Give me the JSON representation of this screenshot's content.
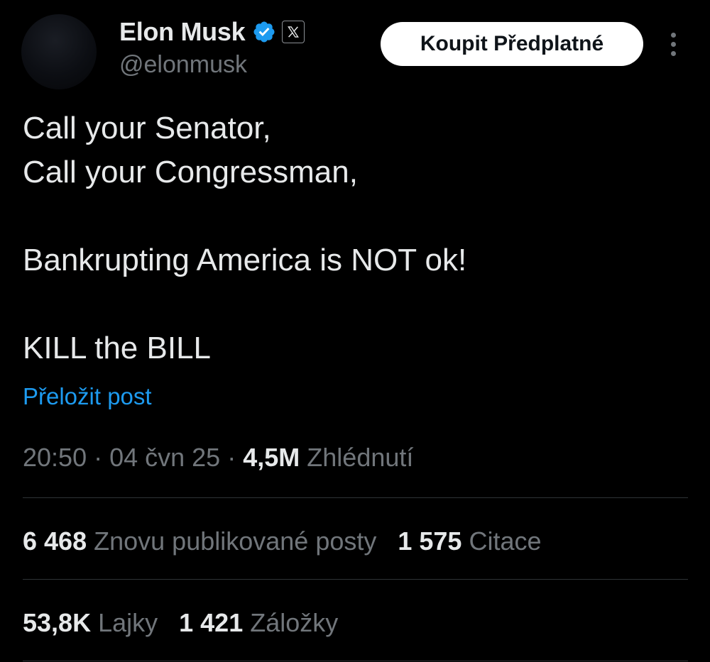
{
  "author": {
    "name": "Elon Musk",
    "handle": "@elonmusk",
    "verified_color": "#1d9bf0",
    "affiliate_icon": "x-logo-icon"
  },
  "header": {
    "subscribe_label": "Koupit Předplatné",
    "more_icon": "more-vertical-icon"
  },
  "tweet": {
    "lines": [
      "Call your Senator,",
      "Call your Congressman,",
      "",
      "Bankrupting America is NOT ok!",
      "",
      "KILL the BILL"
    ],
    "translate_label": "Přeložit post"
  },
  "meta": {
    "time": "20:50",
    "separator": " · ",
    "date": "04 čvn 25",
    "views_count": "4,5M",
    "views_label": "Zhlédnutí"
  },
  "stats": {
    "reposts_count": "6 468",
    "reposts_label": "Znovu publikované posty",
    "quotes_count": "1 575",
    "quotes_label": "Citace",
    "likes_count": "53,8K",
    "likes_label": "Lajky",
    "bookmarks_count": "1 421",
    "bookmarks_label": "Záložky"
  },
  "colors": {
    "background": "#000000",
    "text": "#e7e9ea",
    "secondary": "#71767b",
    "link": "#1d9bf0",
    "divider": "#2f3336"
  }
}
